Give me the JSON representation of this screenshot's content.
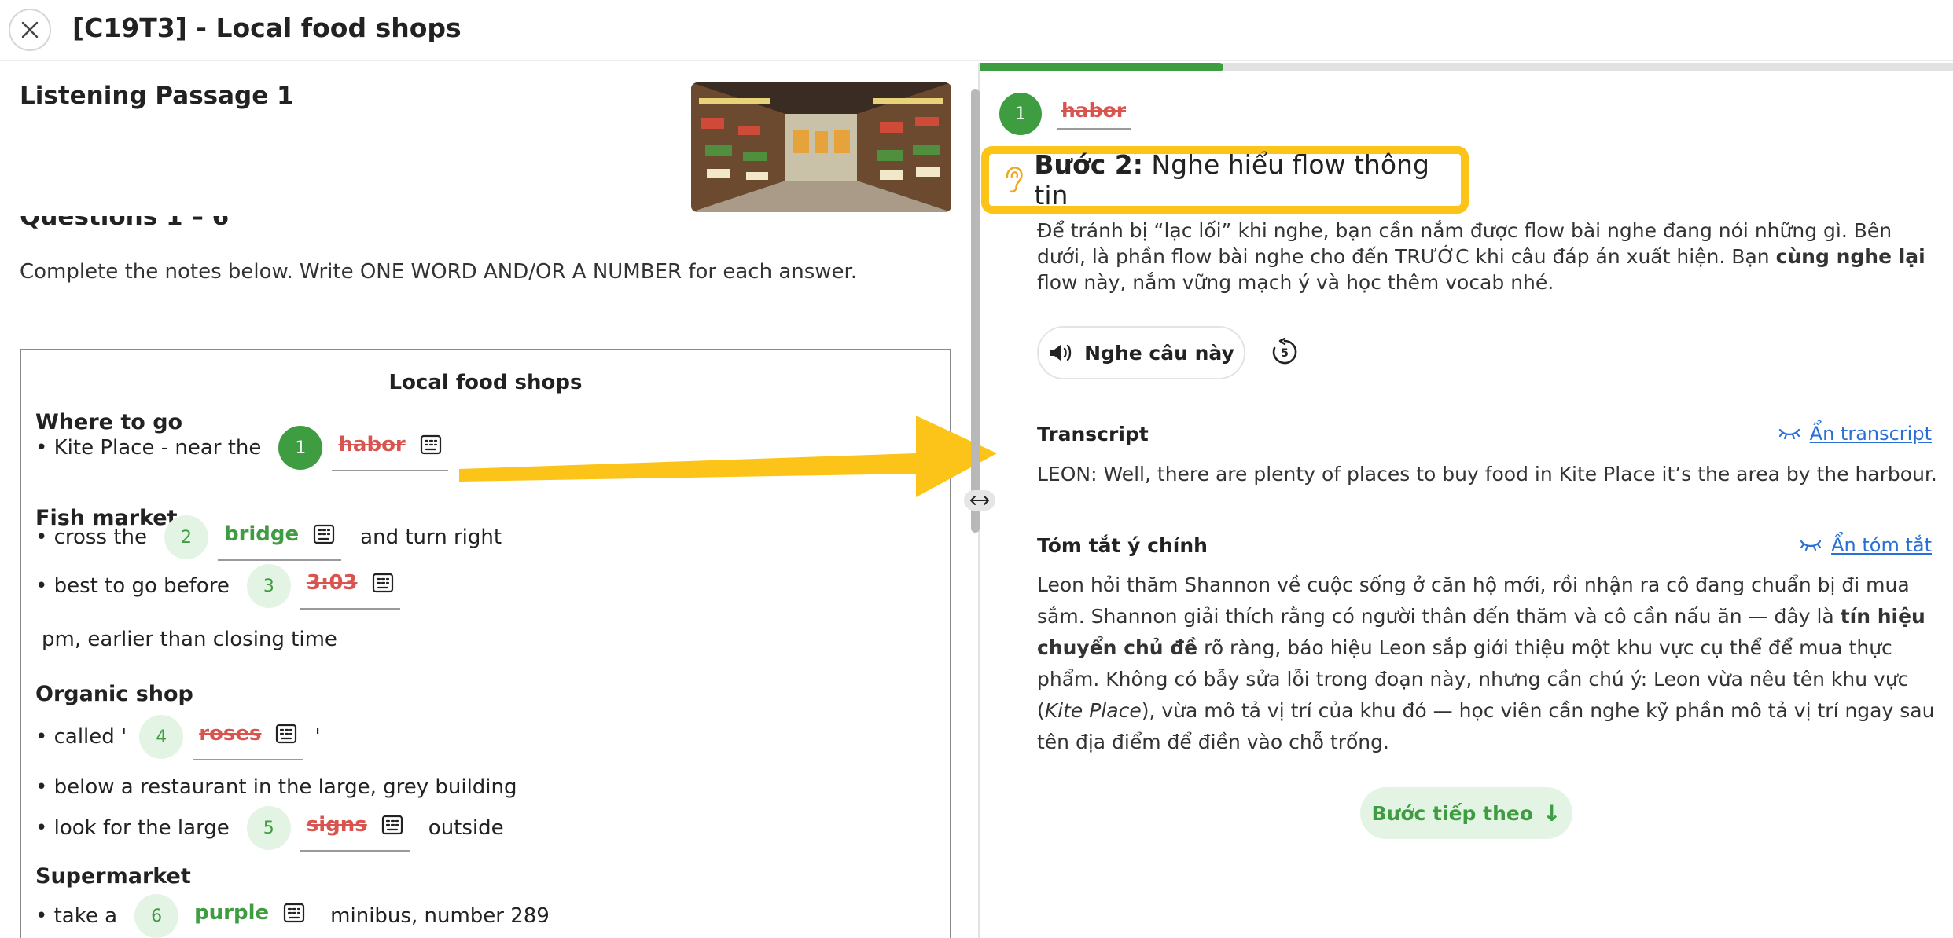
{
  "header": {
    "title": "[C19T3] - Local food shops",
    "close_icon": "close-icon"
  },
  "left": {
    "passage_title": "Listening Passage 1",
    "question_range": "Questions 1 – 6",
    "instructions": "Complete the notes below. Write ONE WORD AND/OR A NUMBER for each answer.",
    "notes": {
      "title": "Local food shops",
      "sections": {
        "where": "Where to go",
        "fish": "Fish market",
        "organic": "Organic shop",
        "supermarket": "Supermarket"
      },
      "lines": [
        {
          "before": "• Kite Place - near the",
          "num": "1",
          "answer": "habor",
          "status": "wrong",
          "after": ""
        },
        {
          "before": "• cross the",
          "num": "2",
          "answer": "bridge",
          "status": "right",
          "after": "and turn right"
        },
        {
          "before": "• best to go before",
          "num": "3",
          "answer": "3:03",
          "status": "wrong",
          "after": ""
        },
        {
          "before": "• called '",
          "num": "4",
          "answer": "roses",
          "status": "wrong",
          "after": "'"
        },
        {
          "before": "• look for the large",
          "num": "5",
          "answer": "signs",
          "status": "wrong",
          "after": "outside"
        },
        {
          "before": "• take a",
          "num": "6",
          "answer": "purple",
          "status": "right",
          "after": "minibus, number 289"
        }
      ],
      "plain_lines": {
        "closing": "pm, earlier than closing time",
        "below_restaurant": "• below a restaurant in the large, grey building"
      }
    }
  },
  "right": {
    "progress_percent": 25,
    "question_chip": {
      "num": "1",
      "answer": "habor"
    },
    "step": {
      "bold": "Bước 2:",
      "text": "Nghe hiểu flow thông tin",
      "icon": "ear-icon"
    },
    "step_desc": {
      "part1": "Để tránh bị “lạc lối” khi nghe, bạn cần nắm được flow bài nghe đang nói những gì. Bên dưới, là phần flow bài nghe cho đến TRƯỚC khi câu đáp án xuất hiện. Bạn ",
      "bold": "cùng nghe lại",
      "part2": " flow này, nắm vững mạch ý và học thêm vocab nhé."
    },
    "listen_button": "Nghe câu này",
    "replay_icon": "replay-5-icon",
    "transcript": {
      "heading": "Transcript",
      "hide_link": "Ẩn transcript",
      "text": "LEON: Well, there are plenty of places to buy food in Kite Place it’s the area by the harbour."
    },
    "summary": {
      "heading": "Tóm tắt ý chính",
      "hide_link": "Ẩn tóm tắt",
      "p1": "Leon hỏi thăm Shannon về cuộc sống ở căn hộ mới, rồi nhận ra cô đang chuẩn bị đi mua sắm. Shannon giải thích rằng có người thân đến thăm và cô cần nấu ăn — đây là ",
      "b1": "tín hiệu chuyển chủ đề",
      "p2": " rõ ràng, báo hiệu Leon sắp giới thiệu một khu vực cụ thể để mua thực phẩm. Không có bẫy sửa lỗi trong đoạn này, nhưng cần chú ý: Leon vừa nêu tên khu vực (",
      "i1": "Kite Place",
      "p3": "), vừa mô tả vị trí của khu đó — học viên cần nghe kỹ phần mô tả vị trí ngay sau tên địa điểm để điền vào chỗ trống."
    },
    "next_button": "Bước tiếp theo",
    "next_icon": "↓"
  },
  "colors": {
    "green": "#3e9c41",
    "red": "#d9534f",
    "yellow": "#fcc419",
    "link": "#2a6fd6"
  }
}
